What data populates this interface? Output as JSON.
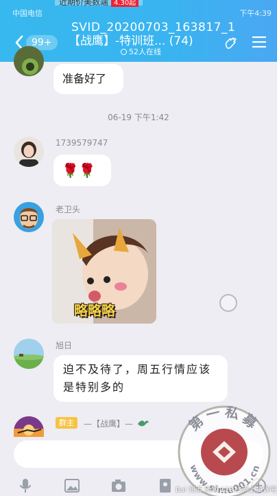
{
  "statusbar": {
    "carrier": "中国电信",
    "time": "下午4:39"
  },
  "banner": {
    "text": "近期价美数端",
    "tag": "4.30起"
  },
  "svid": "SVID_20200703_163817_1",
  "header": {
    "unread_badge": "99+",
    "title": "【战鹰】-特训班... (74)",
    "online": "52人在线"
  },
  "messages": {
    "m1_text": "准备好了",
    "timestamp": "06-19 下午1:42",
    "m2_sender": "1739579747",
    "m2_text": "🌹🌹",
    "m3_sender": "老卫头",
    "m3_sticker_caption": "略略略",
    "m4_sender": "旭日",
    "m4_text": "迫不及待了，周五行情应该是特别多的",
    "m5_owner_tag": "群主",
    "m5_sender": "—【战鹰】—"
  },
  "input": {
    "placeholder": "",
    "value": ""
  },
  "watermark": {
    "top_text": "第一私募",
    "bottom_text": "www.simu001.cn",
    "footer": "Bai 知道 新闻 12315网上投诉吧"
  },
  "colors": {
    "header": "#38b6ee",
    "owner_tag": "#f6c343",
    "chat_bg": "#ededf3"
  }
}
